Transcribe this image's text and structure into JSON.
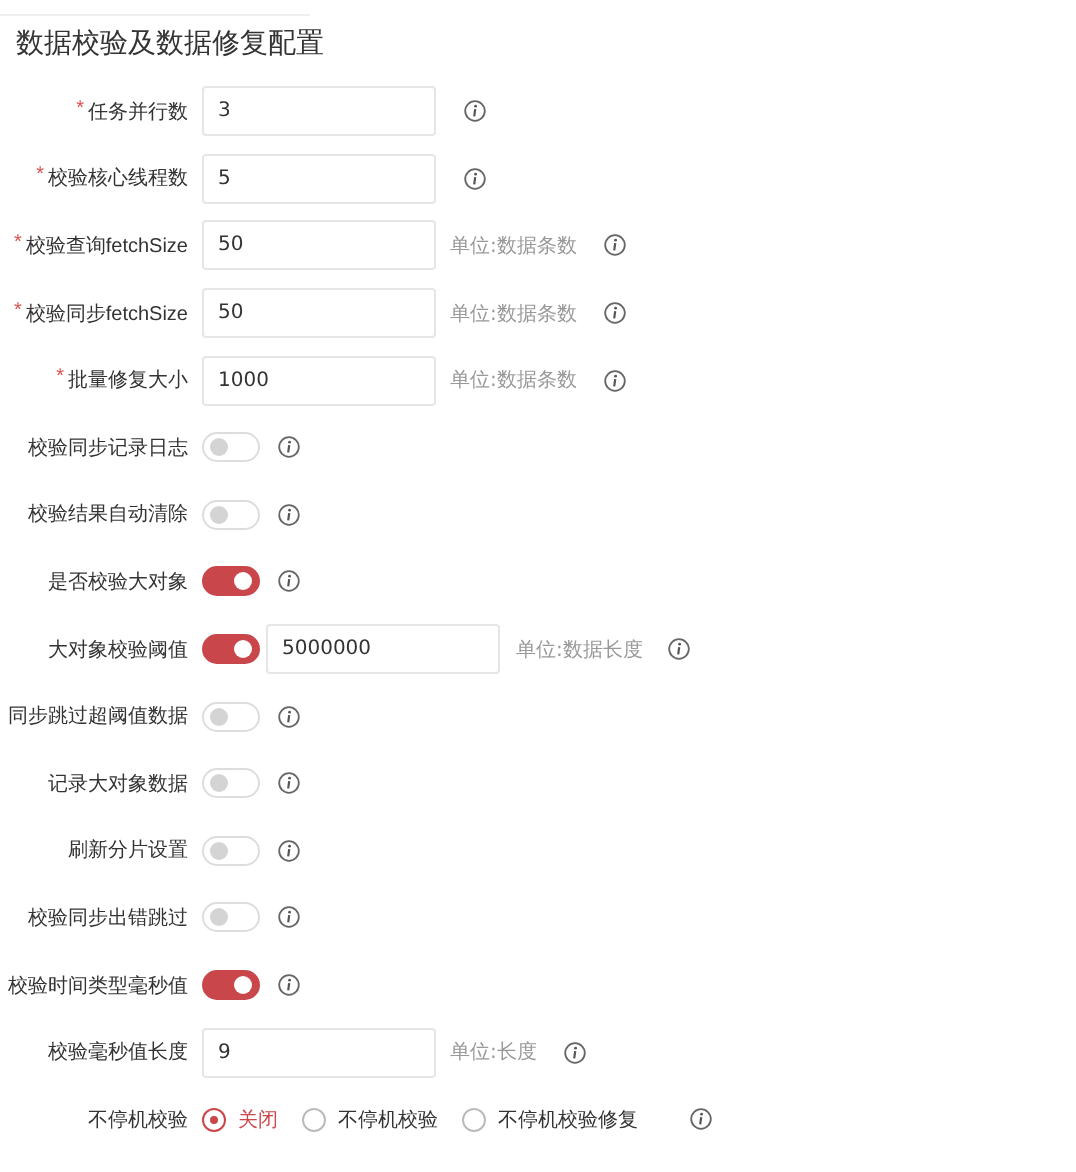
{
  "title": "数据校验及数据修复配置",
  "fields": [
    {
      "kind": "input",
      "required_mark": "*",
      "label": "任务并行数",
      "value": "3"
    },
    {
      "kind": "input",
      "required_mark": "*",
      "label": "校验核心线程数",
      "value": "5"
    },
    {
      "kind": "input",
      "required_mark": "*",
      "label": "校验查询fetchSize",
      "value": "50",
      "unit": "单位:数据条数"
    },
    {
      "kind": "input",
      "required_mark": "*",
      "label": "校验同步fetchSize",
      "value": "50",
      "unit": "单位:数据条数"
    },
    {
      "kind": "input",
      "required_mark": "*",
      "label": "批量修复大小",
      "value": "1000",
      "unit": "单位:数据条数"
    },
    {
      "kind": "toggle",
      "label": "校验同步记录日志",
      "on": false
    },
    {
      "kind": "toggle",
      "label": "校验结果自动清除",
      "on": false
    },
    {
      "kind": "toggle",
      "label": "是否校验大对象",
      "on": true
    },
    {
      "kind": "toggle_input",
      "label": "大对象校验阈值",
      "on": true,
      "value": "5000000",
      "unit": "单位:数据长度"
    },
    {
      "kind": "toggle",
      "label": "同步跳过超阈值数据",
      "on": false
    },
    {
      "kind": "toggle",
      "label": "记录大对象数据",
      "on": false
    },
    {
      "kind": "toggle",
      "label": "刷新分片设置",
      "on": false
    },
    {
      "kind": "toggle",
      "label": "校验同步出错跳过",
      "on": false
    },
    {
      "kind": "toggle",
      "label": "校验时间类型毫秒值",
      "on": true
    },
    {
      "kind": "input",
      "label": "校验毫秒值长度",
      "value": "9",
      "unit": "单位:长度"
    },
    {
      "kind": "radio",
      "label": "不停机校验",
      "options": [
        {
          "label": "关闭",
          "selected": true
        },
        {
          "label": "不停机校验",
          "selected": false
        },
        {
          "label": "不停机校验修复",
          "selected": false
        }
      ]
    }
  ]
}
